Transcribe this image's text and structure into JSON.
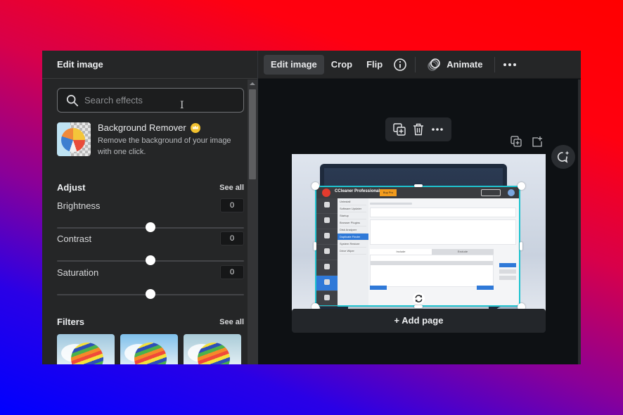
{
  "left_panel": {
    "title": "Edit image",
    "search": {
      "placeholder": "Search effects",
      "value": ""
    },
    "background_remover": {
      "title": "Background Remover",
      "badge_icon": "crown-icon",
      "description": "Remove the background of your image with one click."
    },
    "adjust": {
      "title": "Adjust",
      "see_all": "See all",
      "controls": [
        {
          "label": "Brightness",
          "value": "0",
          "slider_fraction": 0.5
        },
        {
          "label": "Contrast",
          "value": "0",
          "slider_fraction": 0.5
        },
        {
          "label": "Saturation",
          "value": "0",
          "slider_fraction": 0.5
        }
      ]
    },
    "filters": {
      "title": "Filters",
      "see_all": "See all",
      "thumbnails": [
        {
          "name": "filter-1",
          "sky": "#9ec7de"
        },
        {
          "name": "filter-2",
          "sky": "#7fc0ec"
        },
        {
          "name": "filter-3",
          "sky": "#a9cbd8"
        }
      ]
    }
  },
  "toolbar": {
    "edit_image": "Edit image",
    "crop": "Crop",
    "flip": "Flip",
    "info_icon": "info-icon",
    "animate": "Animate",
    "more_icon": "more-icon"
  },
  "canvas": {
    "embedded_app": {
      "title": "CCleaner Professional",
      "buy_button": "Buy Pro",
      "menu_items": [
        "Uninstall",
        "Software Updater",
        "Startup",
        "Browser Plugins",
        "Disk Analyzer",
        "Duplicate Finder",
        "System Restore",
        "Drive Wiper"
      ],
      "selected_menu_index": 5,
      "tabs": [
        "Include",
        "Exclude"
      ]
    },
    "add_page": "+ Add page"
  },
  "colors": {
    "selection_outline": "#1fc3cf",
    "panel_bg": "#252627",
    "canvas_bg": "#0e1114",
    "accent_crown": "#f2c12e"
  }
}
